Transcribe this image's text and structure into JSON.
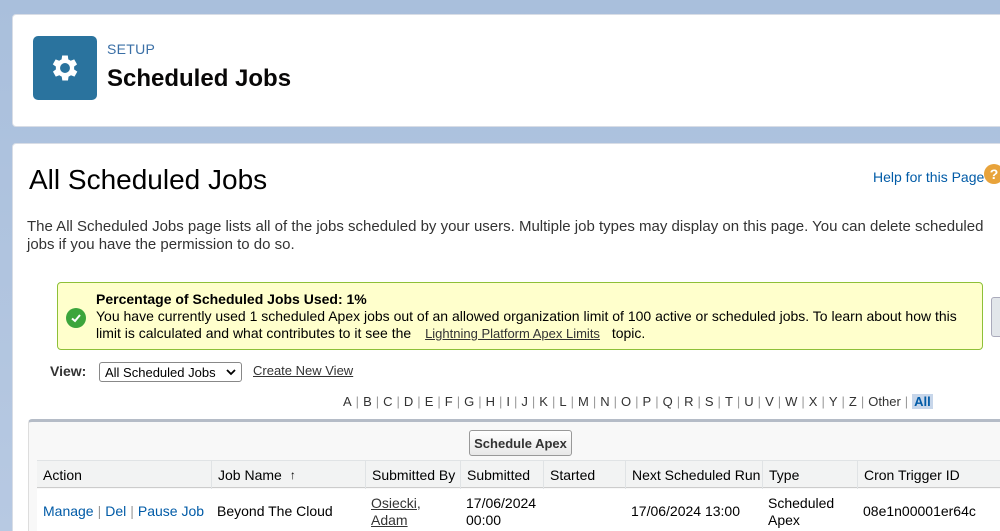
{
  "header": {
    "section": "SETUP",
    "title": "Scheduled Jobs"
  },
  "main": {
    "title": "All Scheduled Jobs",
    "help_link": "Help for this Page",
    "help_icon": "?",
    "description": "The All Scheduled Jobs page lists all of the jobs scheduled by your users. Multiple job types may display on this page. You can delete scheduled jobs if you have the permission to do so."
  },
  "info": {
    "title": "Percentage of Scheduled Jobs Used: 1%",
    "text_before": "You have currently used 1 scheduled Apex jobs out of an allowed organization limit of 100 active or scheduled jobs. To learn about how this limit is calculated and what contributes to it see the",
    "link": "Lightning Platform Apex Limits",
    "text_after": "topic."
  },
  "view": {
    "label": "View:",
    "selected": "All Scheduled Jobs",
    "create_new": "Create New View"
  },
  "alphabet": [
    "A",
    "B",
    "C",
    "D",
    "E",
    "F",
    "G",
    "H",
    "I",
    "J",
    "K",
    "L",
    "M",
    "N",
    "O",
    "P",
    "Q",
    "R",
    "S",
    "T",
    "U",
    "V",
    "W",
    "X",
    "Y",
    "Z",
    "Other",
    "All"
  ],
  "table": {
    "button": "Schedule Apex",
    "sort_indicator": "↑",
    "columns": [
      "Action",
      "Job Name",
      "Submitted By",
      "Submitted",
      "Started",
      "Next Scheduled Run",
      "Type",
      "Cron Trigger ID"
    ],
    "rows": [
      {
        "actions": [
          "Manage",
          "Del",
          "Pause Job"
        ],
        "job_name": "Beyond The Cloud",
        "submitted_by_line1": "Osiecki,",
        "submitted_by_line2": "Adam",
        "submitted_line1": "17/06/2024",
        "submitted_line2": "00:00",
        "started": "",
        "next_run": "17/06/2024 13:00",
        "type_line1": "Scheduled",
        "type_line2": "Apex",
        "cron_id": "08e1n00001er64c"
      }
    ]
  },
  "colors": {
    "icon_bg": "#2a739e",
    "link": "#015ba7",
    "info_bg": "#ffffcc",
    "info_border": "#8ec038",
    "success": "#3ca53c"
  }
}
